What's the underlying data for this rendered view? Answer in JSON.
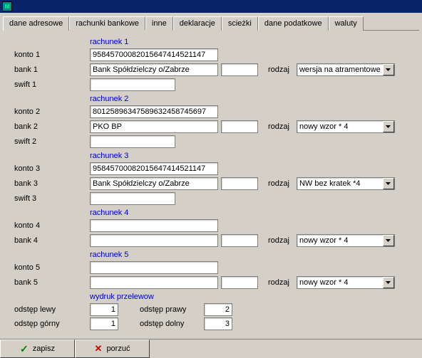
{
  "tabs": [
    "dane adresowe",
    "rachunki bankowe",
    "inne",
    "deklaracje",
    "scieżki",
    "dane podatkowe",
    "waluty"
  ],
  "active_tab": 1,
  "accounts": [
    {
      "header": "rachunek 1",
      "konto_label": "konto  1",
      "bank_label": "bank   1",
      "swift_label": "swift 1",
      "konto": "95845700082015647414521147",
      "bank": "Bank Spółdzielczy o/Zabrze",
      "bank2": "",
      "swift": "",
      "rodzaj_label": "rodzaj",
      "rodzaj": "wersja na atramentowe c"
    },
    {
      "header": "rachunek 2",
      "konto_label": "konto  2",
      "bank_label": "bank   2",
      "swift_label": "swift 2",
      "konto": "80125896347589632458745697",
      "bank": "PKO BP",
      "bank2": "",
      "swift": "",
      "rodzaj_label": "rodzaj",
      "rodzaj": "nowy wzor * 4"
    },
    {
      "header": "rachunek 3",
      "konto_label": "konto  3",
      "bank_label": "bank   3",
      "swift_label": "swift 3",
      "konto": "95845700082015647414521147",
      "bank": "Bank Spółdzielczy o/Zabrze",
      "bank2": "",
      "swift": "",
      "rodzaj_label": "rodzaj",
      "rodzaj": "NW bez kratek *4"
    },
    {
      "header": "rachunek 4",
      "konto_label": "konto  4",
      "bank_label": "bank   4",
      "swift_label": "",
      "konto": "",
      "bank": "",
      "bank2": "",
      "swift": "",
      "rodzaj_label": "rodzaj",
      "rodzaj": "nowy wzor * 4"
    },
    {
      "header": "rachunek 5",
      "konto_label": "konto  5",
      "bank_label": "bank   5",
      "swift_label": "",
      "konto": "",
      "bank": "",
      "bank2": "",
      "swift": "",
      "rodzaj_label": "rodzaj",
      "rodzaj": "nowy wzor * 4"
    }
  ],
  "print": {
    "header": "wydruk przelewow",
    "left_label": "odstęp lewy",
    "left": "1",
    "right_label": "odstęp prawy",
    "right": "2",
    "top_label": "odstęp górny",
    "top": "1",
    "bottom_label": "odstęp dolny",
    "bottom": "3"
  },
  "buttons": {
    "save": "zapisz",
    "cancel": "porzuć"
  }
}
